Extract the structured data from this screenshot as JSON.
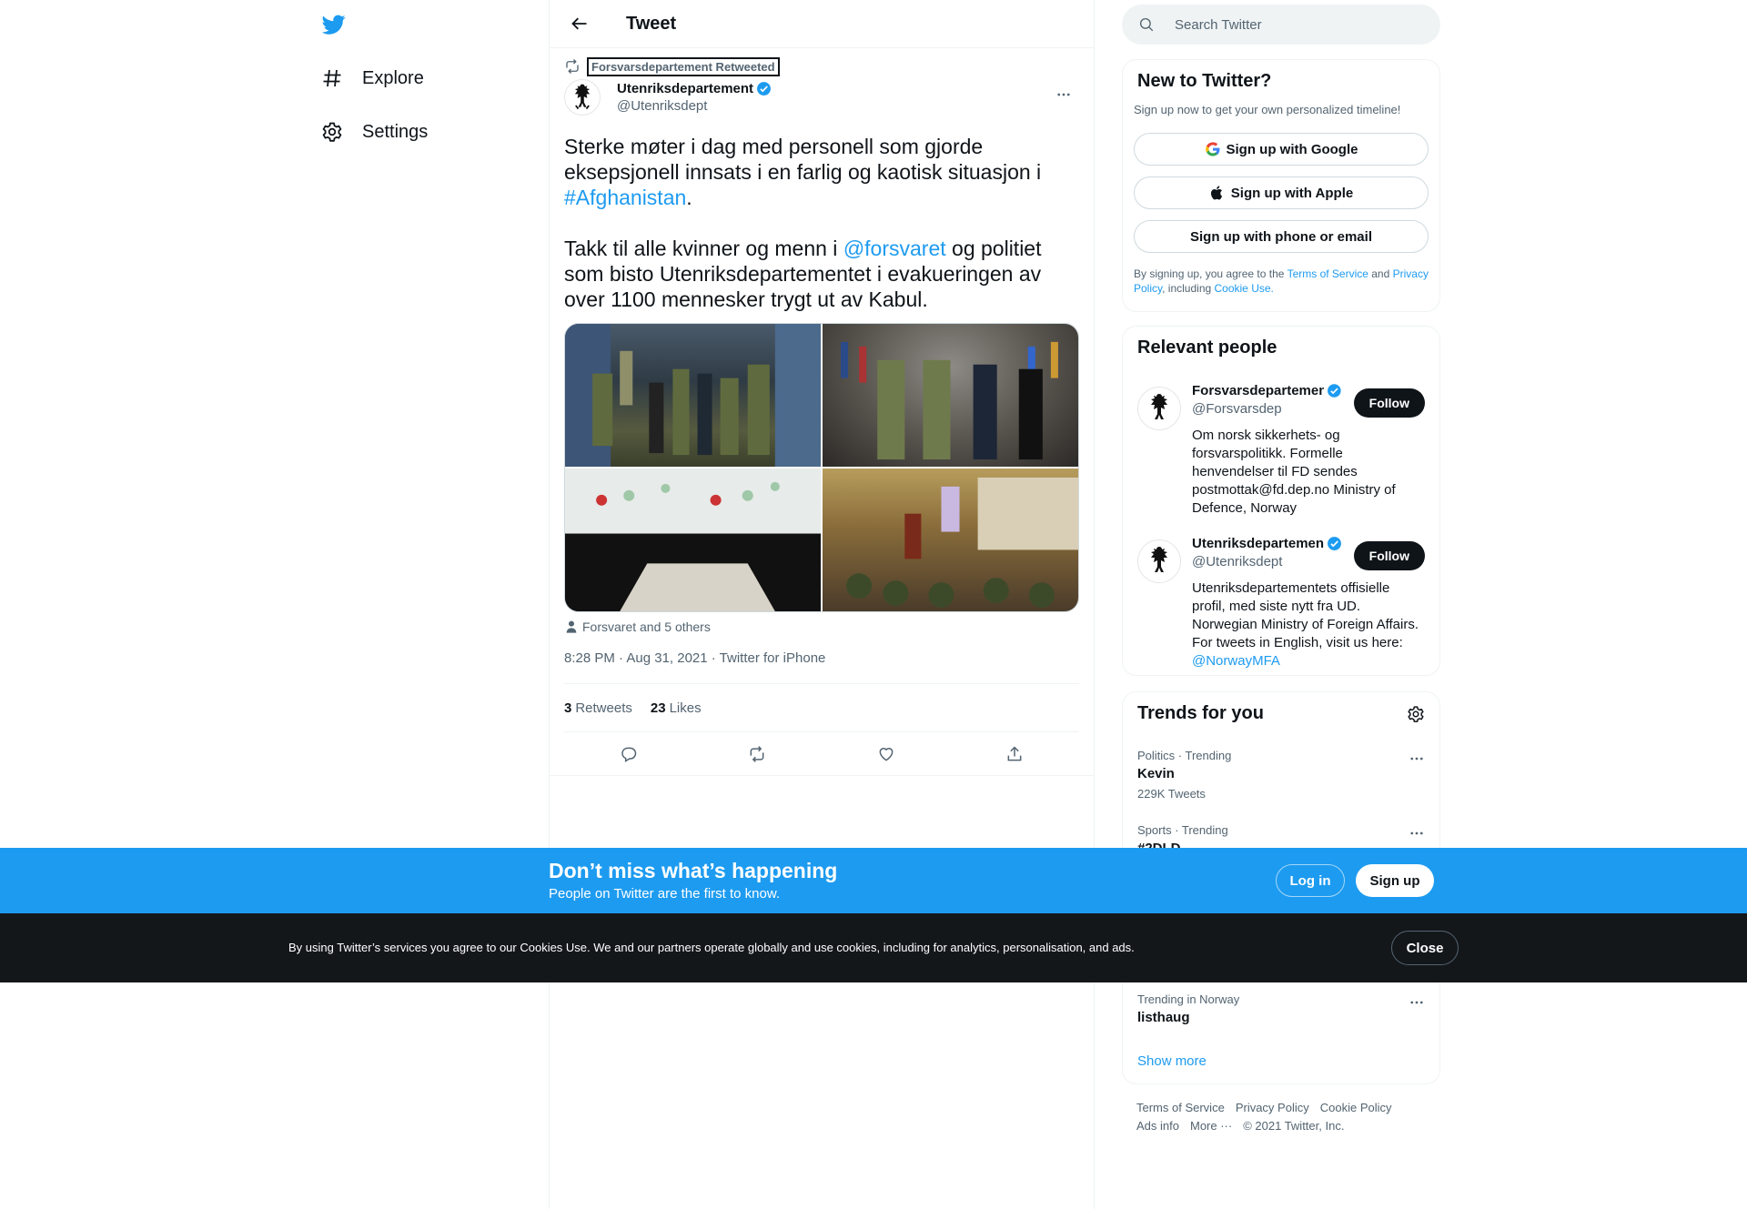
{
  "nav": {
    "logo": "twitter-bird-icon",
    "items": [
      {
        "label": "Explore",
        "icon": "hashtag-icon"
      },
      {
        "label": "Settings",
        "icon": "gear-icon"
      }
    ]
  },
  "header": {
    "title": "Tweet"
  },
  "tweet": {
    "retweet_context": "Forsvarsdepartement Retweeted",
    "author_name": "Utenriksdepartement",
    "author_handle": "@Utenriksdept",
    "text_p1a": "Sterke møter i dag med personell som gjorde eksepsjonell innsats i en farlig og kaotisk situasjon i ",
    "hashtag": "#Afghanistan",
    "text_p1b": ".",
    "text_p2a": "Takk til alle kvinner og menn i ",
    "mention": "@forsvaret",
    "text_p2b": " og politiet som bisto Utenriksdepartementet i evakueringen av over 1100 mennesker trygt ut av Kabul.",
    "tagged": "Forsvaret and 5 others",
    "timestamp": "8:28 PM · Aug 31, 2021 · Twitter for iPhone",
    "retweets_count": "3",
    "retweets_label": "Retweets",
    "likes_count": "23",
    "likes_label": "Likes"
  },
  "search": {
    "placeholder": "Search Twitter"
  },
  "new_to_twitter": {
    "title": "New to Twitter?",
    "subtitle": "Sign up now to get your own personalized timeline!",
    "google": "Sign up with Google",
    "apple": "Sign up with Apple",
    "phone": "Sign up with phone or email",
    "legal_1": "By signing up, you agree to the ",
    "terms": "Terms of Service",
    "legal_2": " and ",
    "privacy": "Privacy Policy",
    "legal_3": ", including ",
    "cookie": "Cookie Use."
  },
  "relevant_people": {
    "title": "Relevant people",
    "people": [
      {
        "name": "Forsvarsdepartemen",
        "handle": "@Forsvarsdep",
        "bio": "Om norsk sikkerhets- og forsvarspolitikk. Formelle henvendelser til FD sendes postmottak@fd.dep.no Ministry of Defence, Norway",
        "follow": "Follow"
      },
      {
        "name": "Utenriksdepartemen",
        "handle": "@Utenriksdept",
        "bio": "Utenriksdepartementets offisielle profil, med siste nytt fra UD. Norwegian Ministry of Foreign Affairs. For tweets in English, visit us here: ",
        "bio_link": "@NorwayMFA",
        "follow": "Follow"
      }
    ]
  },
  "trends": {
    "title": "Trends for you",
    "items": [
      {
        "context": "Politics · Trending",
        "name": "Kevin",
        "count": "229K Tweets"
      },
      {
        "context": "Sports · Trending",
        "name": "#2DLD",
        "count": ""
      },
      {
        "context": "Trending in Norway",
        "name": "listhaug",
        "count": ""
      }
    ],
    "show_more": "Show more"
  },
  "footer": {
    "links": [
      "Terms of Service",
      "Privacy Policy",
      "Cookie Policy",
      "Ads info",
      "More ···"
    ],
    "copyright": "© 2021 Twitter, Inc."
  },
  "bottom_bar": {
    "title": "Don’t miss what’s happening",
    "subtitle": "People on Twitter are the first to know.",
    "login": "Log in",
    "signup": "Sign up"
  },
  "cookie_bar": {
    "text": "By using Twitter’s services you agree to our Cookies Use. We and our partners operate globally and use cookies, including for analytics, personalisation, and ads.",
    "close": "Close"
  },
  "colors": {
    "accent": "#1d9bf0",
    "text": "#0f1419",
    "secondary": "#536471",
    "cookie_bg": "#14171a"
  }
}
